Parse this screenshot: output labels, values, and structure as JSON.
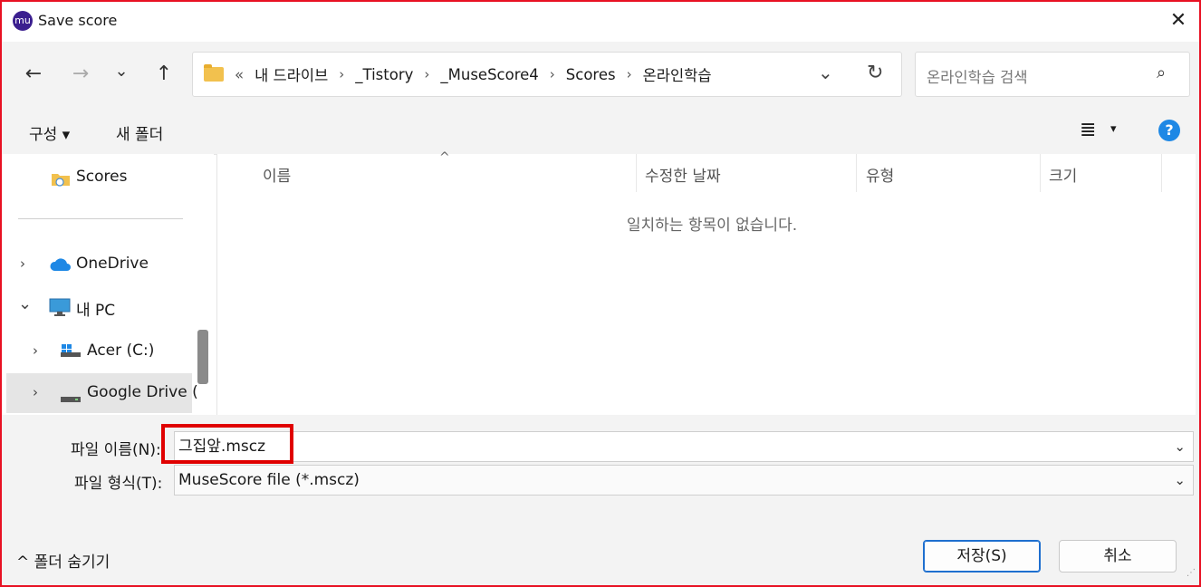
{
  "window": {
    "title": "Save score",
    "app_icon_glyph": "mu",
    "close_glyph": "✕"
  },
  "nav": {
    "back": "←",
    "forward": "→",
    "recent": "⌄",
    "up": "↑"
  },
  "address": {
    "overflow": "«",
    "crumbs": [
      "내 드라이브",
      "_Tistory",
      "_MuseScore4",
      "Scores",
      "온라인학습"
    ],
    "separator": "›",
    "dropdown": "⌄",
    "refresh": "↻"
  },
  "search": {
    "placeholder": "온라인학습 검색",
    "icon": "⌕"
  },
  "commands": {
    "organize": "구성 ▾",
    "new_folder": "새 폴더",
    "view_icon": "≣",
    "view_dropdown": "▾",
    "help": "?"
  },
  "sidebar": {
    "items": [
      {
        "label": "Scores",
        "chevron": "",
        "icon": "folder-icon"
      },
      {
        "label": "OneDrive",
        "chevron": "›",
        "icon": "cloud-icon"
      },
      {
        "label": "내 PC",
        "chevron": "⌄",
        "icon": "monitor-icon"
      },
      {
        "label": "Acer (C:)",
        "chevron": "›",
        "icon": "drive-icon"
      },
      {
        "label": "Google Drive (",
        "chevron": "›",
        "icon": "drive-icon"
      }
    ]
  },
  "list": {
    "columns": [
      "이름",
      "수정한 날짜",
      "유형",
      "크기"
    ],
    "sort_indicator": "^",
    "empty_message": "일치하는 항목이 없습니다."
  },
  "form": {
    "filename_label": "파일 이름(N):",
    "filename_value": "그집앞.mscz",
    "filetype_label": "파일 형식(T):",
    "filetype_value": "MuseScore file (*.mscz)",
    "dropdown_glyph": "⌄"
  },
  "footer": {
    "hide_folders": "^ 폴더 숨기기",
    "save": "저장(S)",
    "cancel": "취소"
  },
  "colors": {
    "highlight": "#e00000",
    "window_border": "#e81123",
    "help_blue": "#1e88e5"
  }
}
